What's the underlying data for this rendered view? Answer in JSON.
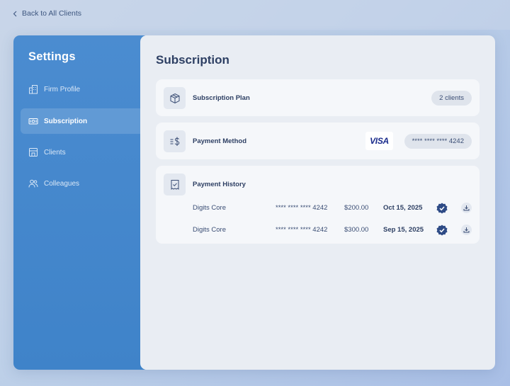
{
  "nav": {
    "back_label": "Back to All Clients"
  },
  "sidebar": {
    "title": "Settings",
    "items": [
      {
        "label": "Firm Profile",
        "icon": "building-icon"
      },
      {
        "label": "Subscription",
        "icon": "banknote-icon",
        "active": true
      },
      {
        "label": "Clients",
        "icon": "storefront-icon"
      },
      {
        "label": "Colleagues",
        "icon": "users-icon"
      }
    ]
  },
  "main": {
    "title": "Subscription",
    "plan": {
      "label": "Subscription Plan",
      "badge": "2 clients",
      "icon": "box-icon"
    },
    "payment_method": {
      "label": "Payment Method",
      "card_brand": "VISA",
      "card_number": "**** **** **** 4242",
      "icon": "dollar-list-icon"
    },
    "history": {
      "label": "Payment History",
      "icon": "receipt-check-icon",
      "rows": [
        {
          "product": "Digits Core",
          "card": "**** **** **** 4242",
          "amount": "$200.00",
          "date": "Oct 15, 2025",
          "status_icon": "verified-badge-icon",
          "action_icon": "download-icon"
        },
        {
          "product": "Digits Core",
          "card": "**** **** **** 4242",
          "amount": "$300.00",
          "date": "Sep 15, 2025",
          "status_icon": "verified-badge-icon",
          "action_icon": "download-icon"
        }
      ]
    }
  },
  "colors": {
    "sidebar": "#4b8cd0",
    "main_bg": "#e9edf3",
    "card_bg": "#f5f7fa",
    "text_dark": "#2d3f63",
    "badge": "#2e4b86",
    "visa_blue": "#1a2b8c"
  }
}
